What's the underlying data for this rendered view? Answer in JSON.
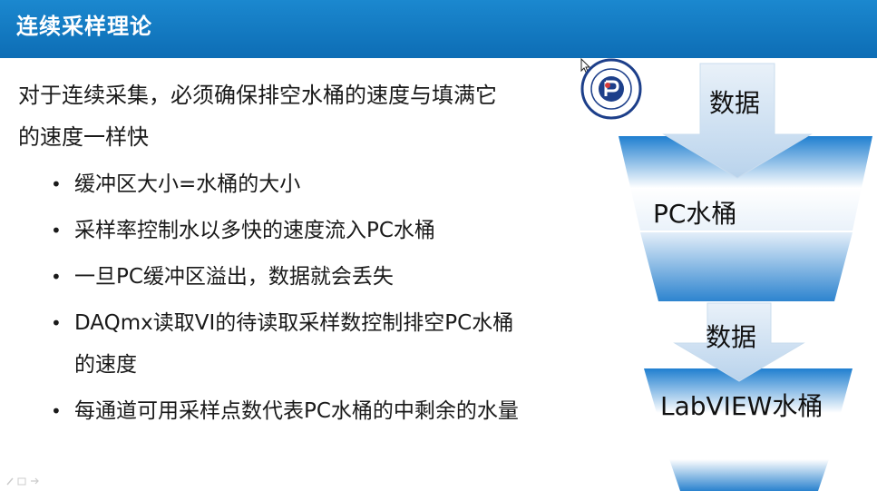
{
  "slide": {
    "title": "连续采样理论",
    "intro": "对于连续采集，必须确保排空水桶的速度与填满它的速度一样快",
    "bullets": [
      "缓冲区大小=水桶的大小",
      "采样率控制水以多快的速度流入PC水桶",
      "一旦PC缓冲区溢出，数据就会丢失",
      "DAQmx读取VI的待读取采样数控制排空PC水桶的速度",
      "每通道可用采样点数代表PC水桶的中剩余的水量"
    ]
  },
  "diagram": {
    "label_data_top": "数据",
    "label_pc_bucket": "PC水桶",
    "label_data_mid": "数据",
    "label_labview_bucket": "LabVIEW水桶"
  },
  "colors": {
    "title_bar": "#1b88cf",
    "bucket_blue": "#1f7fd0",
    "arrow_light": "#dbe9f6"
  },
  "icons": {
    "bullet": "•",
    "cursor": "mouse-pointer-icon",
    "logo": "university-logo-icon"
  }
}
